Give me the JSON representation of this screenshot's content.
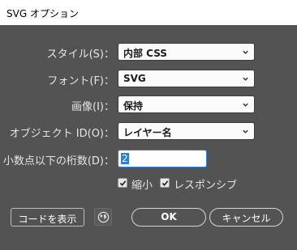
{
  "window": {
    "title": "SVG オプション"
  },
  "form": {
    "style": {
      "label": "スタイル(S)：",
      "value": "内部 CSS"
    },
    "font": {
      "label": "フォント(F)：",
      "value": "SVG"
    },
    "image": {
      "label": "画像(I)：",
      "value": "保持"
    },
    "object_id": {
      "label": "オブジェクト ID(O)：",
      "value": "レイヤー名"
    },
    "decimals": {
      "label": "小数点以下の桁数(D)：",
      "value": "2"
    }
  },
  "options": {
    "minify": {
      "label": "縮小",
      "checked": true
    },
    "responsive": {
      "label": "レスポンシブ",
      "checked": true
    }
  },
  "buttons": {
    "show_code": "コードを表示",
    "ok": "OK",
    "cancel": "キャンセル"
  },
  "icons": {
    "dropdown": "chevron-down-icon",
    "checkbox": "checkmark-icon",
    "globe": "globe-icon"
  },
  "colors": {
    "dialog_bg": "#535353",
    "focus_blue": "#2f7fd8",
    "text_light": "#e6e6e6"
  }
}
